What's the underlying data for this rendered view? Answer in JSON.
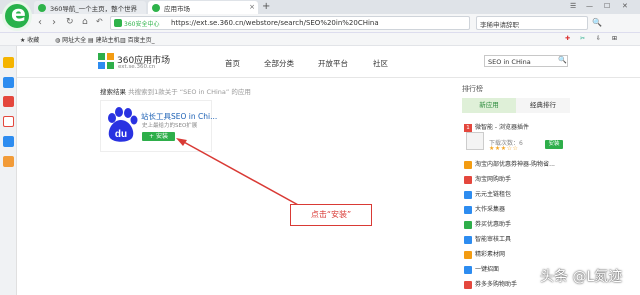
{
  "browser": {
    "tabs": [
      {
        "label": "360导航_一个主页，整个世界",
        "active": false
      },
      {
        "label": "应用市场",
        "active": true
      }
    ],
    "new_tab": "+",
    "address": {
      "safe_label": "360安全中心",
      "url": "https://ext.se.360.cn/webstore/search/SEO%20in%20CHina"
    },
    "search_box": "李稀申请辞职",
    "bookmarks": [
      "收藏",
      "网址大全",
      "建站主机",
      "百度主页_"
    ]
  },
  "site": {
    "name": "360应用市场",
    "url": "ext.se.360.cn",
    "nav": [
      "首页",
      "全部分类",
      "开放平台",
      "社区"
    ],
    "search_value": "SEO in CHina"
  },
  "results": {
    "heading": "搜索结果",
    "summary": "共搜索到1款关于 “SEO in CHina” 的应用",
    "app": {
      "name": "站长工具SEO in Chi...",
      "desc": "史上最给力的SEO扩展",
      "install_label": "+ 安装"
    }
  },
  "ranking": {
    "title": "排行榜",
    "tabs": [
      "新应用",
      "经典排行"
    ],
    "top_item": {
      "num": "1",
      "name": "微智能 - 浏览器插件",
      "downloads": "下载次数：6",
      "stars": "★★★☆☆",
      "install_label": "安装"
    },
    "items": [
      {
        "num": "2",
        "name": "淘宝内部优惠券神器-购物省..."
      },
      {
        "num": "3",
        "name": "淘宝网购助手"
      },
      {
        "num": "4",
        "name": "元元主链租包"
      },
      {
        "num": "5",
        "name": "大作采集器"
      },
      {
        "num": "6",
        "name": "券买优惠助手"
      },
      {
        "num": "7",
        "name": "智能审核工具"
      },
      {
        "num": "8",
        "name": "精彩素材网"
      },
      {
        "num": "9",
        "name": "一键招面"
      },
      {
        "num": "10",
        "name": "券多多购物助手"
      }
    ]
  },
  "annotation": "点击“安装”",
  "watermark": "头条 @L氮迹",
  "colors": {
    "accent_green": "#2eae4a",
    "annotation_red": "#d93a35",
    "link_blue": "#1a5fb4"
  }
}
